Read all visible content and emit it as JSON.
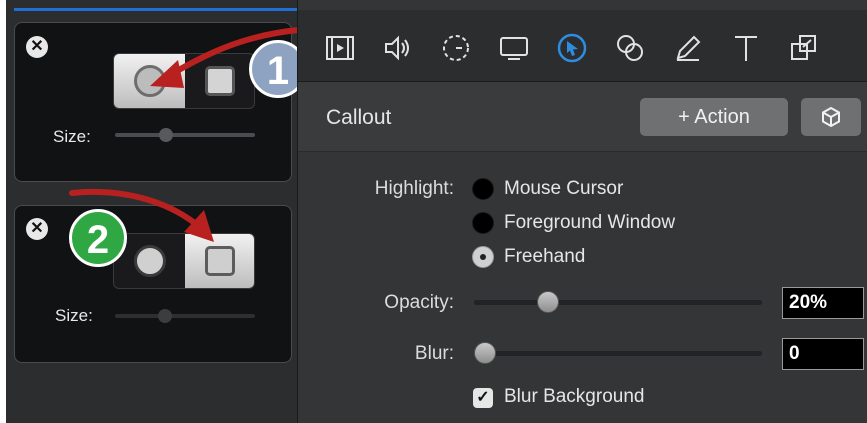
{
  "cards": [
    {
      "close_glyph": "✕",
      "size_label": "Size:",
      "selected_shape": "circle",
      "badge": {
        "number": "1",
        "color": "#8ea3c2"
      }
    },
    {
      "close_glyph": "✕",
      "size_label": "Size:",
      "selected_shape": "square",
      "badge": {
        "number": "2",
        "color": "#2fa844"
      }
    }
  ],
  "toolbar": {
    "tools": [
      "video-clip-icon",
      "audio-icon",
      "animation-icon",
      "screen-icon",
      "cursor-icon",
      "filter-icon",
      "annotation-pencil-icon",
      "text-icon",
      "gesture-icon"
    ],
    "active_tool": "cursor-icon",
    "active_color": "#2f8de0"
  },
  "panel": {
    "title": "Callout",
    "action_button": "+ Action",
    "cube_icon": "cube-icon",
    "highlight_label": "Highlight:",
    "highlight_options": [
      "Mouse Cursor",
      "Foreground Window",
      "Freehand"
    ],
    "highlight_selected": "Freehand",
    "opacity_label": "Opacity:",
    "opacity_value": "20%",
    "opacity_fraction": 0.2,
    "blur_label": "Blur:",
    "blur_value": "0",
    "blur_fraction": 0,
    "blur_background_label": "Blur Background",
    "blur_background_checked": true
  },
  "colors": {
    "arrow": "#b8211f",
    "accent": "#2f8de0"
  }
}
